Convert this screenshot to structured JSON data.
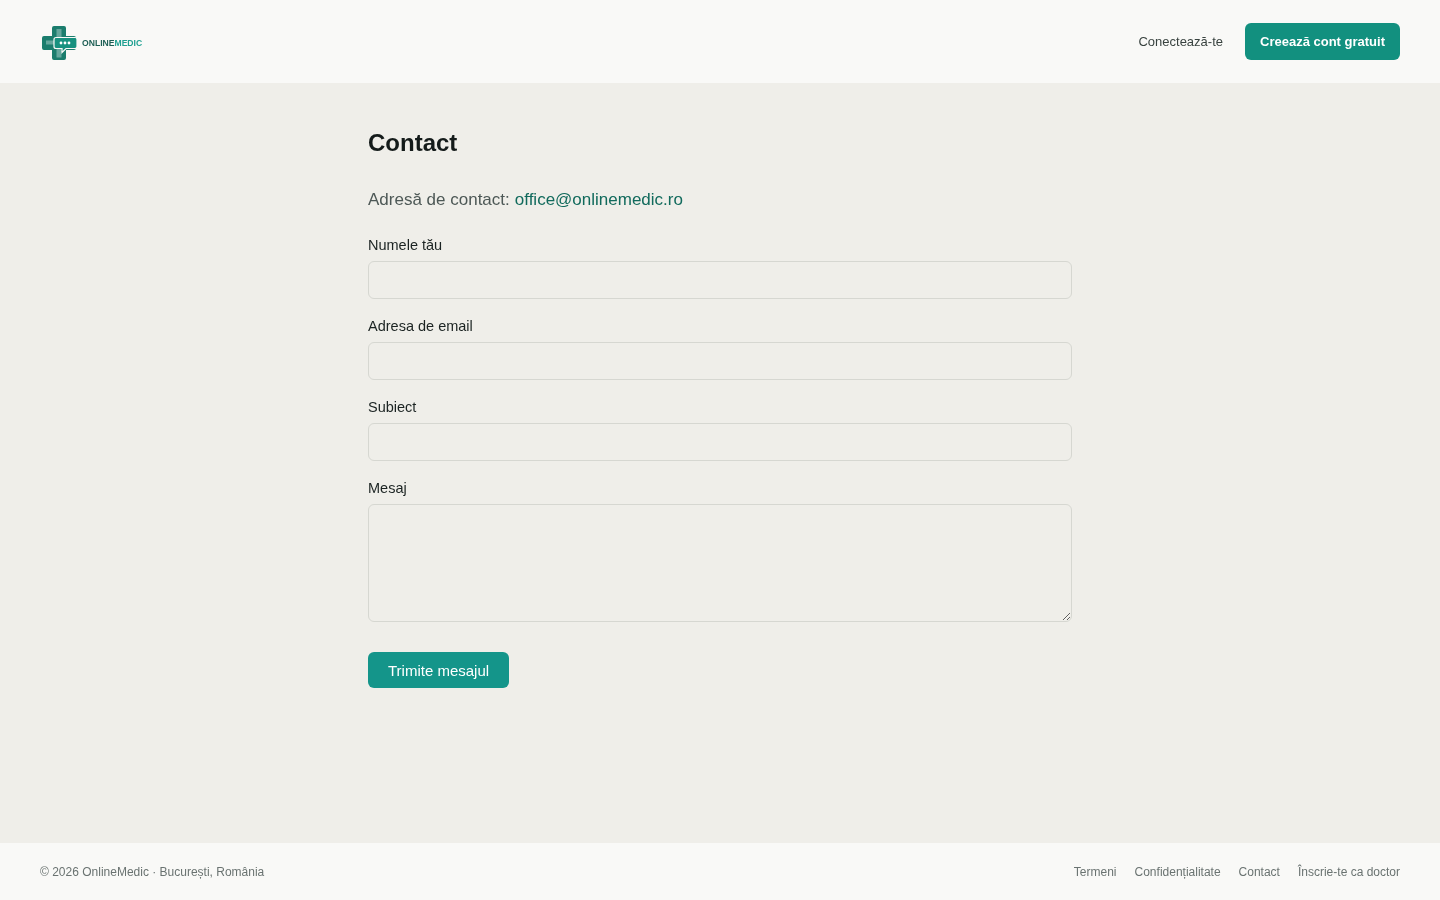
{
  "header": {
    "logo": {
      "wordmark": [
        "ONLINE",
        "MEDIC"
      ]
    },
    "login_link": "Conectează-te",
    "signup_button": "Creează cont gratuit"
  },
  "page": {
    "title": "Contact",
    "contact_line": {
      "label": "Adresă de contact:",
      "email": "office@onlinemedic.ro"
    },
    "form": {
      "fields": [
        {
          "label": "Numele tău",
          "kind": "input"
        },
        {
          "label": "Adresa de email",
          "kind": "input"
        },
        {
          "label": "Subiect",
          "kind": "input"
        },
        {
          "label": "Mesaj",
          "kind": "textarea"
        }
      ],
      "submit_button": "Trimite mesajul"
    }
  },
  "footer": {
    "copyright": "© 2026 OnlineMedic · București, România",
    "links": [
      "Termeni",
      "Confidențialitate",
      "Contact",
      "Înscrie-te ca doctor"
    ]
  }
}
